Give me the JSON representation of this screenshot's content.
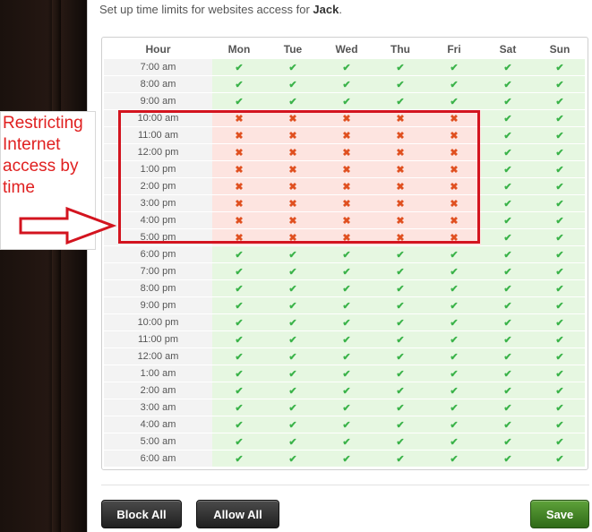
{
  "intro": {
    "prefix": "Set up time limits for websites access for ",
    "user": "Jack",
    "suffix": "."
  },
  "schedule": {
    "hour_header": "Hour",
    "days": [
      "Mon",
      "Tue",
      "Wed",
      "Thu",
      "Fri",
      "Sat",
      "Sun"
    ],
    "allow_symbol": "✔",
    "block_symbol": "✖",
    "rows": [
      {
        "hour": "7:00 am",
        "cells": [
          1,
          1,
          1,
          1,
          1,
          1,
          1
        ]
      },
      {
        "hour": "8:00 am",
        "cells": [
          1,
          1,
          1,
          1,
          1,
          1,
          1
        ]
      },
      {
        "hour": "9:00 am",
        "cells": [
          1,
          1,
          1,
          1,
          1,
          1,
          1
        ]
      },
      {
        "hour": "10:00 am",
        "cells": [
          0,
          0,
          0,
          0,
          0,
          1,
          1
        ]
      },
      {
        "hour": "11:00 am",
        "cells": [
          0,
          0,
          0,
          0,
          0,
          1,
          1
        ]
      },
      {
        "hour": "12:00 pm",
        "cells": [
          0,
          0,
          0,
          0,
          0,
          1,
          1
        ]
      },
      {
        "hour": "1:00 pm",
        "cells": [
          0,
          0,
          0,
          0,
          0,
          1,
          1
        ]
      },
      {
        "hour": "2:00 pm",
        "cells": [
          0,
          0,
          0,
          0,
          0,
          1,
          1
        ]
      },
      {
        "hour": "3:00 pm",
        "cells": [
          0,
          0,
          0,
          0,
          0,
          1,
          1
        ]
      },
      {
        "hour": "4:00 pm",
        "cells": [
          0,
          0,
          0,
          0,
          0,
          1,
          1
        ]
      },
      {
        "hour": "5:00 pm",
        "cells": [
          0,
          0,
          0,
          0,
          0,
          1,
          1
        ]
      },
      {
        "hour": "6:00 pm",
        "cells": [
          1,
          1,
          1,
          1,
          1,
          1,
          1
        ]
      },
      {
        "hour": "7:00 pm",
        "cells": [
          1,
          1,
          1,
          1,
          1,
          1,
          1
        ]
      },
      {
        "hour": "8:00 pm",
        "cells": [
          1,
          1,
          1,
          1,
          1,
          1,
          1
        ]
      },
      {
        "hour": "9:00 pm",
        "cells": [
          1,
          1,
          1,
          1,
          1,
          1,
          1
        ]
      },
      {
        "hour": "10:00 pm",
        "cells": [
          1,
          1,
          1,
          1,
          1,
          1,
          1
        ]
      },
      {
        "hour": "11:00 pm",
        "cells": [
          1,
          1,
          1,
          1,
          1,
          1,
          1
        ]
      },
      {
        "hour": "12:00 am",
        "cells": [
          1,
          1,
          1,
          1,
          1,
          1,
          1
        ]
      },
      {
        "hour": "1:00 am",
        "cells": [
          1,
          1,
          1,
          1,
          1,
          1,
          1
        ]
      },
      {
        "hour": "2:00 am",
        "cells": [
          1,
          1,
          1,
          1,
          1,
          1,
          1
        ]
      },
      {
        "hour": "3:00 am",
        "cells": [
          1,
          1,
          1,
          1,
          1,
          1,
          1
        ]
      },
      {
        "hour": "4:00 am",
        "cells": [
          1,
          1,
          1,
          1,
          1,
          1,
          1
        ]
      },
      {
        "hour": "5:00 am",
        "cells": [
          1,
          1,
          1,
          1,
          1,
          1,
          1
        ]
      },
      {
        "hour": "6:00 am",
        "cells": [
          1,
          1,
          1,
          1,
          1,
          1,
          1
        ]
      }
    ]
  },
  "buttons": {
    "block_all": "Block All",
    "allow_all": "Allow All",
    "save": "Save"
  },
  "annotation": {
    "lines": [
      "Restricting",
      "Internet",
      "access by",
      "time"
    ]
  },
  "colors": {
    "allow_bg": "#e6f7e1",
    "allow_mark": "#3bb34a",
    "block_bg": "#fde4e0",
    "block_mark": "#e05020",
    "highlight": "#d3141f",
    "save_green": "#4a8a28"
  },
  "icons": {
    "allow": "check-icon",
    "block": "cross-icon",
    "annotation_arrow": "arrow-right-icon"
  }
}
